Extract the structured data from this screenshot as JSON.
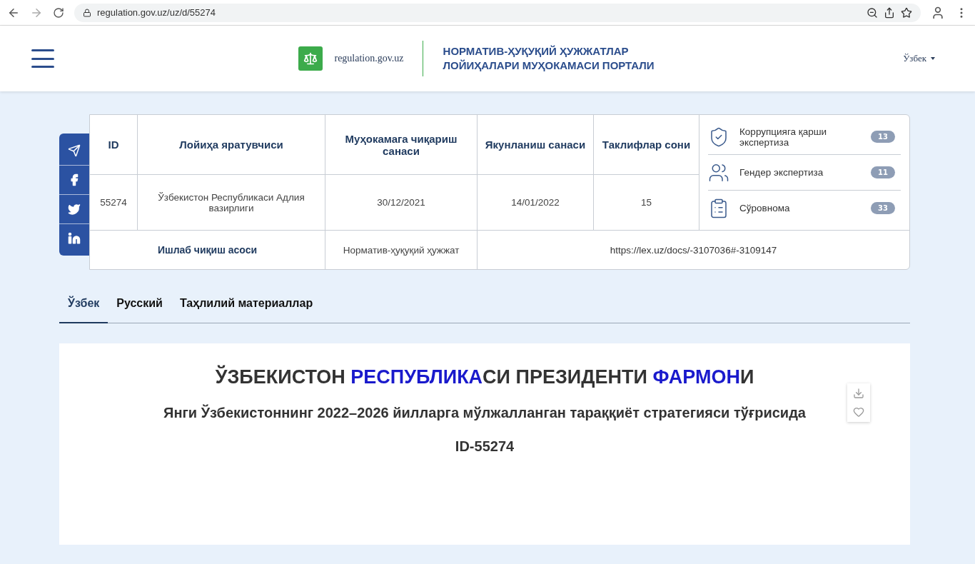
{
  "browser": {
    "url": "regulation.gov.uz/uz/d/55274"
  },
  "header": {
    "logo_text": "regulation.gov.uz",
    "portal_title": [
      "НОРМАТИВ-ҲУҚУҚИЙ ҲУЖЖАТЛАР",
      "ЛОЙИҲАЛАРИ МУҲОКАМАСИ ПОРТАЛИ"
    ],
    "language": "Ўзбек"
  },
  "share_bar": [
    {
      "kind": "telegram"
    },
    {
      "kind": "facebook"
    },
    {
      "kind": "twitter"
    },
    {
      "kind": "linkedin"
    }
  ],
  "table": {
    "columns": [
      "ID",
      "Лойиҳа яратувчиси",
      "Муҳокамага чиқариш санаси",
      "Якунланиш санаси",
      "Таклифлар сони"
    ],
    "row": [
      "55274",
      "Ўзбекистон Республикаси Адлия вазирлиги",
      "30/12/2021",
      "14/01/2022",
      "15"
    ],
    "basis_label": "Ишлаб чиқиш асоси",
    "basis_type": "Норматив-ҳуқуқий ҳужжат",
    "basis_link": "https://lex.uz/docs/-3107036#-3109147"
  },
  "expertise": [
    {
      "kind": "corruption",
      "label": "Коррупцияга қарши экспертиза",
      "count": "13"
    },
    {
      "kind": "gender",
      "label": "Гендер экспертиза",
      "count": "11"
    },
    {
      "kind": "survey",
      "label": "Сўровнома",
      "count": "33"
    }
  ],
  "tabs": [
    {
      "label": "Ўзбек",
      "selected": true
    },
    {
      "label": "Русский",
      "selected": false
    },
    {
      "label": "Таҳлилий материаллар",
      "selected": false
    }
  ],
  "document": {
    "heading": "ЎЗБЕКИСТОН **РЕСПУБЛИКА**СИ ПРЕЗИДЕНТИ **ФАРМОН**И",
    "subtitle": "Янги Ўзбекистоннинг 2022–2026 йилларга мўлжалланган тараққиёт стратегияси тўғрисида",
    "id": "ID-55274"
  }
}
